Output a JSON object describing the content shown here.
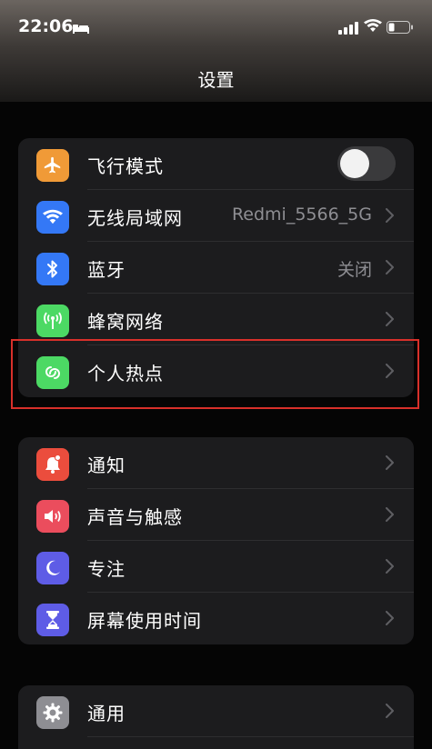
{
  "status_bar": {
    "time": "22:06",
    "icons": [
      "bed-icon",
      "signal-icon",
      "wifi-icon",
      "battery-icon"
    ]
  },
  "nav": {
    "title": "设置"
  },
  "groups": [
    {
      "items": [
        {
          "label": "飞行模式",
          "icon": "airplane-icon",
          "icon_color": "#f09a37",
          "control": "toggle",
          "toggle_on": false
        },
        {
          "label": "无线局域网",
          "icon": "wifi-icon",
          "icon_color": "#3478f6",
          "value": "Redmi_5566_5G",
          "control": "chevron"
        },
        {
          "label": "蓝牙",
          "icon": "bluetooth-icon",
          "icon_color": "#3478f6",
          "value": "关闭",
          "control": "chevron"
        },
        {
          "label": "蜂窝网络",
          "icon": "antenna-icon",
          "icon_color": "#4cd964",
          "control": "chevron"
        },
        {
          "label": "个人热点",
          "icon": "hotspot-icon",
          "icon_color": "#4cd964",
          "control": "chevron",
          "highlighted": true
        }
      ]
    },
    {
      "items": [
        {
          "label": "通知",
          "icon": "notification-icon",
          "icon_color": "#eb4d3d",
          "control": "chevron"
        },
        {
          "label": "声音与触感",
          "icon": "speaker-icon",
          "icon_color": "#eb4d5d",
          "control": "chevron"
        },
        {
          "label": "专注",
          "icon": "moon-icon",
          "icon_color": "#5e5ce6",
          "control": "chevron"
        },
        {
          "label": "屏幕使用时间",
          "icon": "hourglass-icon",
          "icon_color": "#5e5ce6",
          "control": "chevron"
        }
      ]
    },
    {
      "items": [
        {
          "label": "通用",
          "icon": "gear-icon",
          "icon_color": "#8e8e93",
          "control": "chevron"
        }
      ]
    }
  ],
  "colors": {
    "background": "#050505",
    "group_background": "#1c1c1e",
    "highlight_border": "#d8302a"
  }
}
